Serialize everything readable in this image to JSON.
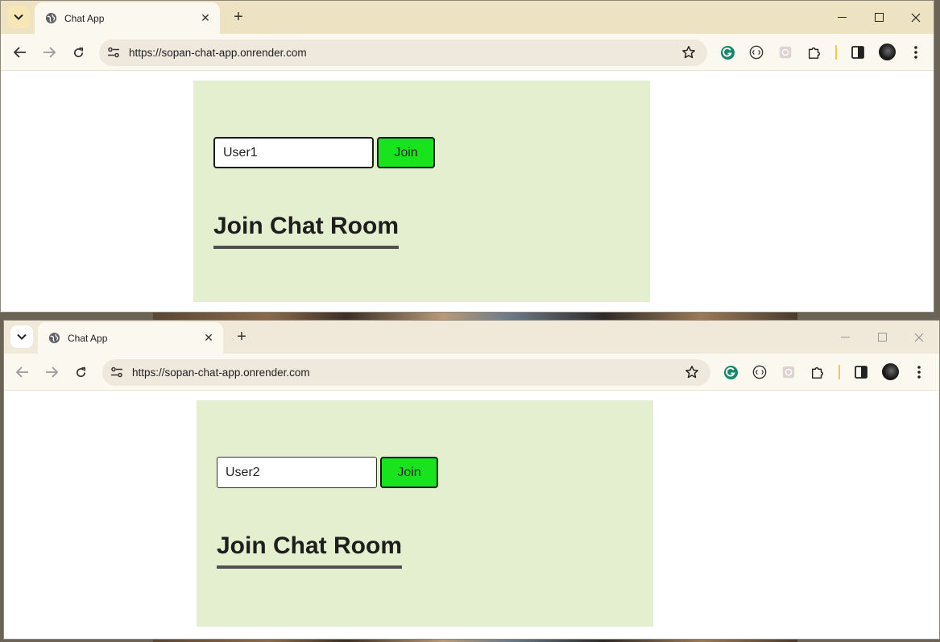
{
  "windows": [
    {
      "tab_title": "Chat App",
      "url": "https://sopan-chat-app.onrender.com",
      "username_value": "User1",
      "join_label": "Join",
      "heading": "Join Chat Room"
    },
    {
      "tab_title": "Chat App",
      "url": "https://sopan-chat-app.onrender.com",
      "username_value": "User2",
      "join_label": "Join",
      "heading": "Join Chat Room"
    }
  ],
  "colors": {
    "panel_bg": "#e4efcf",
    "join_button": "#17e41d",
    "active_tabstrip": "#ede2c2",
    "inactive_tabstrip": "#f0e9d9"
  },
  "icons": [
    "tab-search-icon",
    "globe-icon",
    "close-icon",
    "plus-icon",
    "minimize-icon",
    "maximize-icon",
    "back-icon",
    "forward-icon",
    "reload-icon",
    "site-settings-icon",
    "bookmark-star-icon",
    "grammarly-icon",
    "extension-icon",
    "puzzle-icon",
    "side-panel-icon",
    "profile-avatar",
    "more-menu-icon"
  ]
}
